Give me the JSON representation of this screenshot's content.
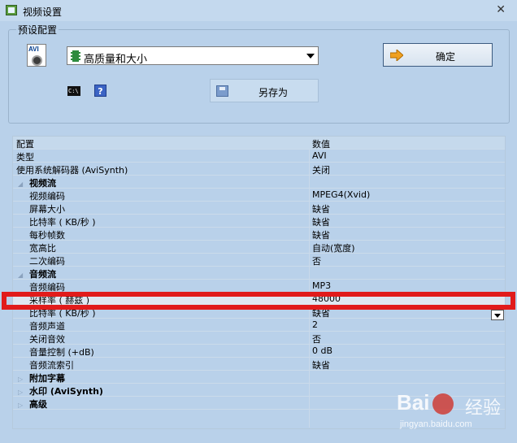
{
  "window": {
    "title": "视频设置"
  },
  "preset_group": {
    "title": "预设配置",
    "selected": "高质量和大小",
    "ok_label": "确定",
    "saveas_label": "另存为",
    "cmd_icon_text": "C:\\",
    "help_icon_text": "?"
  },
  "grid": {
    "headers": [
      "配置",
      "数值"
    ],
    "rows": [
      {
        "name": "类型",
        "value": "AVI"
      },
      {
        "name": "使用系统解码器 (AviSynth)",
        "value": "关闭"
      }
    ],
    "video": {
      "label": "视频流",
      "rows": [
        {
          "name": "视频编码",
          "value": "MPEG4(Xvid)"
        },
        {
          "name": "屏幕大小",
          "value": "缺省"
        },
        {
          "name": "比特率 ( KB/秒 )",
          "value": "缺省"
        },
        {
          "name": "每秒帧数",
          "value": "缺省"
        },
        {
          "name": "宽高比",
          "value": "自动(宽度)"
        },
        {
          "name": "二次编码",
          "value": "否"
        }
      ]
    },
    "audio": {
      "label": "音频流",
      "rows": [
        {
          "name": "音频编码",
          "value": "MP3"
        },
        {
          "name": "采样率 ( 赫兹 )",
          "value": "48000"
        },
        {
          "name": "比特率 ( KB/秒 )",
          "value": "缺省"
        },
        {
          "name": "音频声道",
          "value": "2"
        },
        {
          "name": "关闭音效",
          "value": "否"
        },
        {
          "name": "音量控制 (+dB)",
          "value": "0 dB"
        },
        {
          "name": "音频流索引",
          "value": "缺省"
        }
      ]
    },
    "collapsed": [
      {
        "label": "附加字幕"
      },
      {
        "label": "水印 (AviSynth)"
      },
      {
        "label": "高级"
      }
    ]
  },
  "watermark": {
    "logo": "Bai",
    "logo2": "经验",
    "url": "jingyan.baidu.com"
  }
}
